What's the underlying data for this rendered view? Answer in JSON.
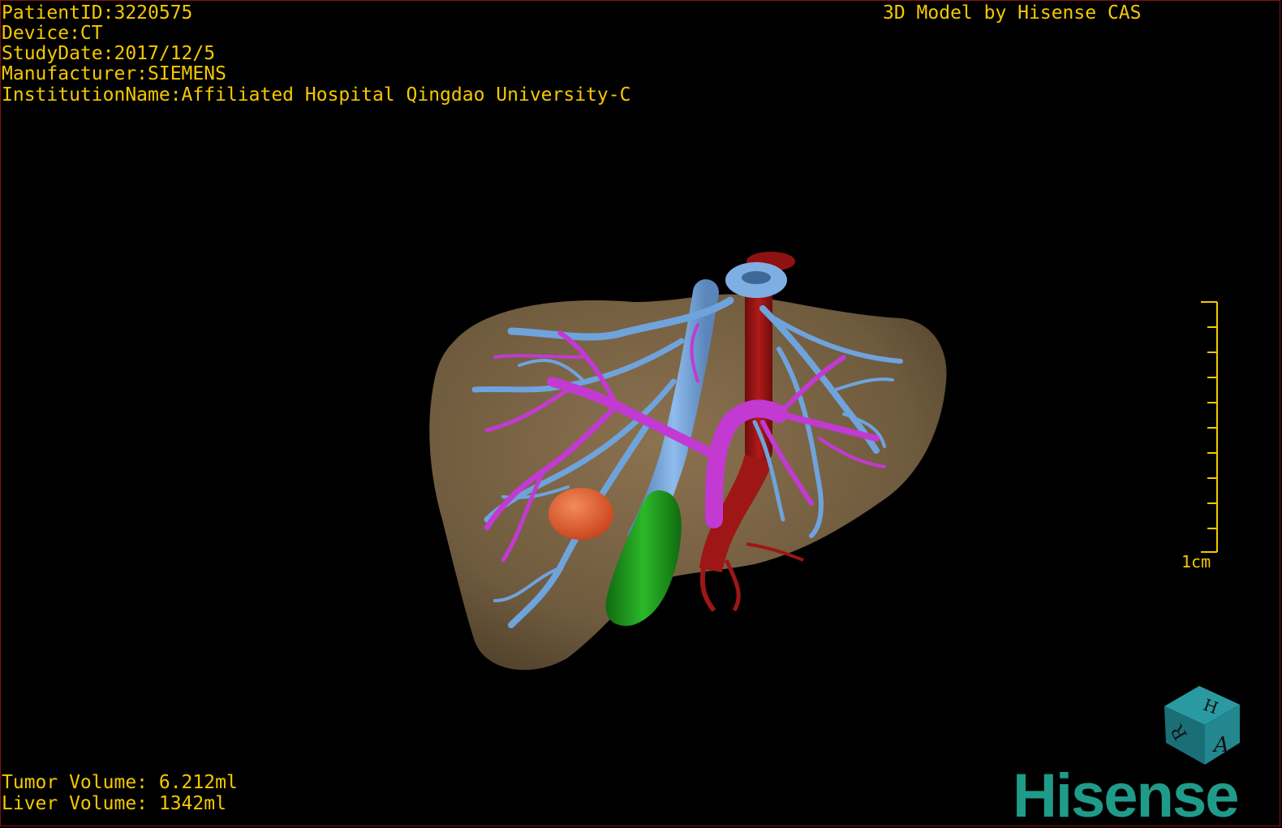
{
  "header": {
    "patient_id": "PatientID:3220575",
    "device": "Device:CT",
    "study_date": "StudyDate:2017/12/5",
    "manufacturer": "Manufacturer:SIEMENS",
    "institution": "InstitutionName:Affiliated Hospital Qingdao University-C",
    "model_credit": "3D Model by Hisense CAS"
  },
  "volumes": {
    "tumor": "Tumor Volume: 6.212ml",
    "liver": "Liver Volume: 1342ml"
  },
  "scale_bar": {
    "label": "1cm",
    "ticks": 11
  },
  "orientation_cube": {
    "labels": [
      "H",
      "R",
      "A"
    ],
    "color": "#1f7f86"
  },
  "brand": {
    "text": "Hisense",
    "color": "#1f9b8a"
  },
  "colors": {
    "overlay_text": "#f5c800",
    "liver": "#7d6645",
    "hepatic_vein": "#6fa3dc",
    "portal_vein": "#c23ad2",
    "artery": "#9b1414",
    "tumor": "#e8602c",
    "gallbladder": "#1f9a1a"
  }
}
